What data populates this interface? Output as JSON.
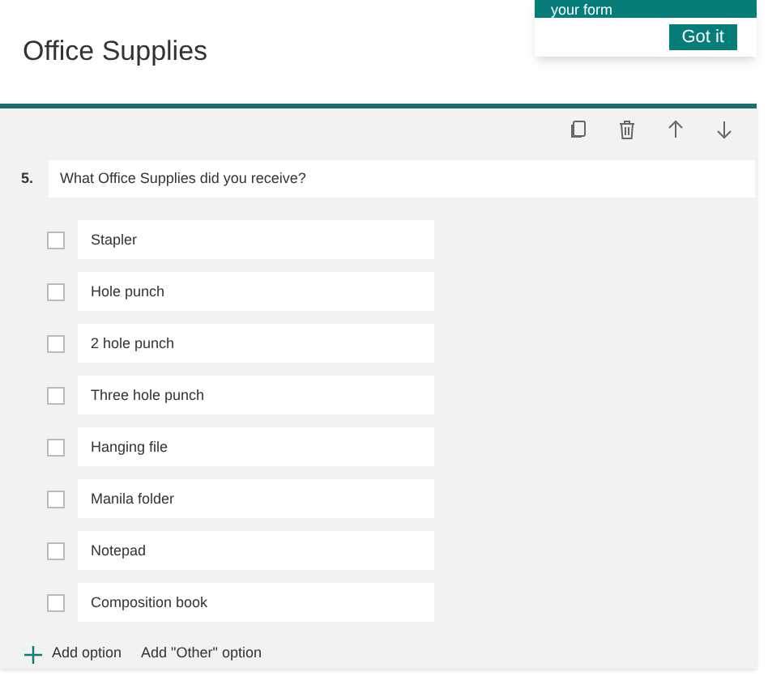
{
  "form_title": "Office Supplies",
  "popup": {
    "message": "your form",
    "button": "Got it"
  },
  "question": {
    "number": "5.",
    "text": "What Office Supplies did you receive?",
    "options": [
      {
        "label": "Stapler",
        "checked": false
      },
      {
        "label": "Hole punch",
        "checked": false
      },
      {
        "label": "2 hole punch",
        "checked": false
      },
      {
        "label": "Three hole punch",
        "checked": false
      },
      {
        "label": "Hanging file",
        "checked": false
      },
      {
        "label": "Manila folder",
        "checked": false
      },
      {
        "label": "Notepad",
        "checked": false
      },
      {
        "label": "Composition book",
        "checked": false
      }
    ],
    "add_option": "Add option",
    "add_other": "Add \"Other\" option"
  }
}
